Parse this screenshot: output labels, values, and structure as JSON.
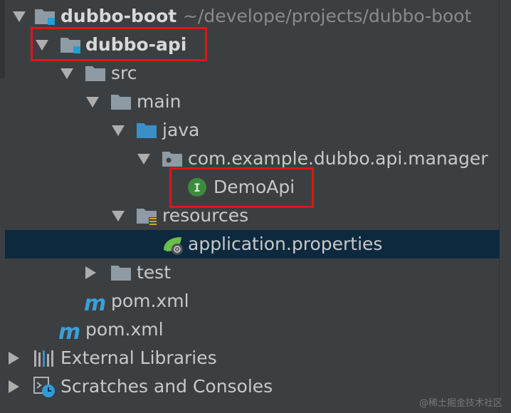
{
  "tree": {
    "root": {
      "name": "dubbo-boot",
      "path": "~/develope/projects/dubbo-boot"
    },
    "api_module": "dubbo-api",
    "src": "src",
    "main": "main",
    "java": "java",
    "package": "com.example.dubbo.api.manager",
    "interface": "DemoApi",
    "interface_badge": "I",
    "resources": "resources",
    "properties_file": "application.properties",
    "test": "test",
    "module_pom": "pom.xml",
    "root_pom": "pom.xml",
    "maven_glyph": "m",
    "external_libraries": "External Libraries",
    "scratches": "Scratches and Consoles"
  },
  "colors": {
    "background": "#3c3f41",
    "selection": "#0d293e",
    "highlight_box": "#e0141a",
    "folder": "#8e9aa4",
    "source_folder": "#3a8fc4",
    "interface_green": "#3d8b3d"
  },
  "watermark": "@稀土掘金技术社区"
}
